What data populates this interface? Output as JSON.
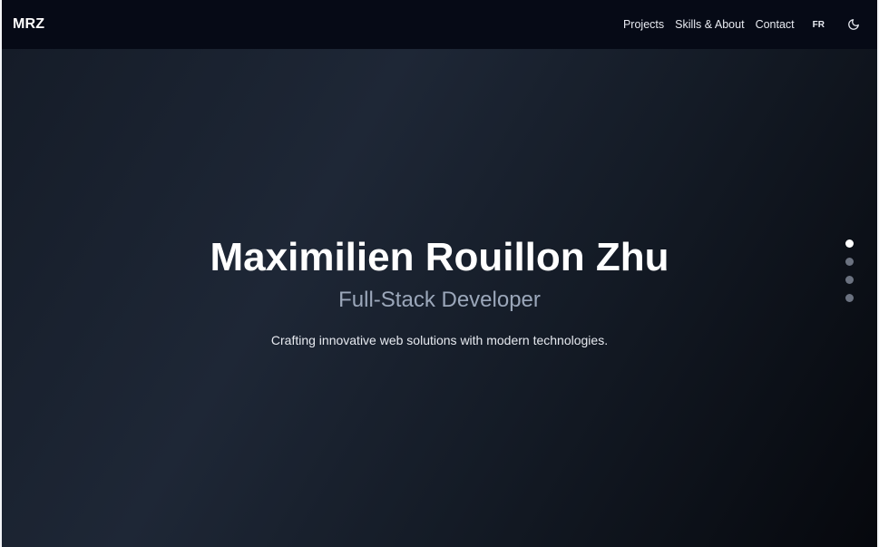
{
  "header": {
    "logo": "MRZ",
    "nav": [
      {
        "label": "Projects"
      },
      {
        "label": "Skills & About"
      },
      {
        "label": "Contact"
      }
    ],
    "language": "FR",
    "theme_icon": "moon-icon"
  },
  "hero": {
    "title": "Maximilien Rouillon Zhu",
    "subtitle": "Full-Stack Developer",
    "tagline": "Crafting innovative web solutions with modern technologies."
  },
  "section_nav": {
    "count": 4,
    "active_index": 0
  }
}
